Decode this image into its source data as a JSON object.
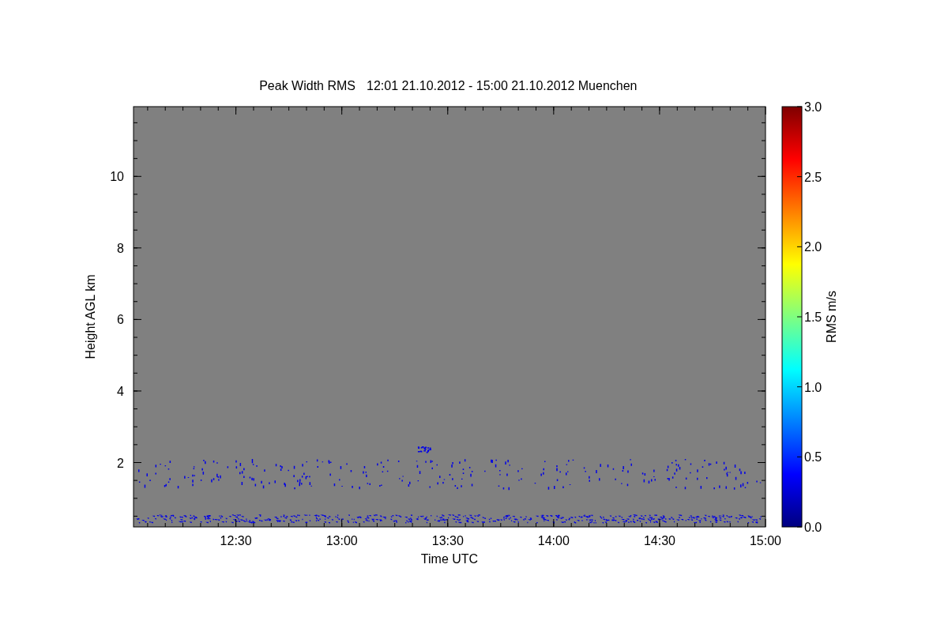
{
  "figure": {
    "title": "Peak Width RMS",
    "subtitle": "12:01 21.10.2012 - 15:00 21.10.2012 Muenchen",
    "x_axis": {
      "label": "Time UTC",
      "tick_labels": [
        "12:30",
        "13:00",
        "13:30",
        "14:00",
        "14:30",
        "15:00"
      ]
    },
    "y_axis": {
      "label": "Height AGL km",
      "tick_labels": [
        "10",
        "8",
        "6",
        "4",
        "2"
      ]
    },
    "colorbar": {
      "label": "RMS m/s",
      "ticks": [
        "3.0",
        "2.5",
        "2.0",
        "1.5",
        "1.0",
        "0.5",
        "0.0"
      ]
    }
  }
}
